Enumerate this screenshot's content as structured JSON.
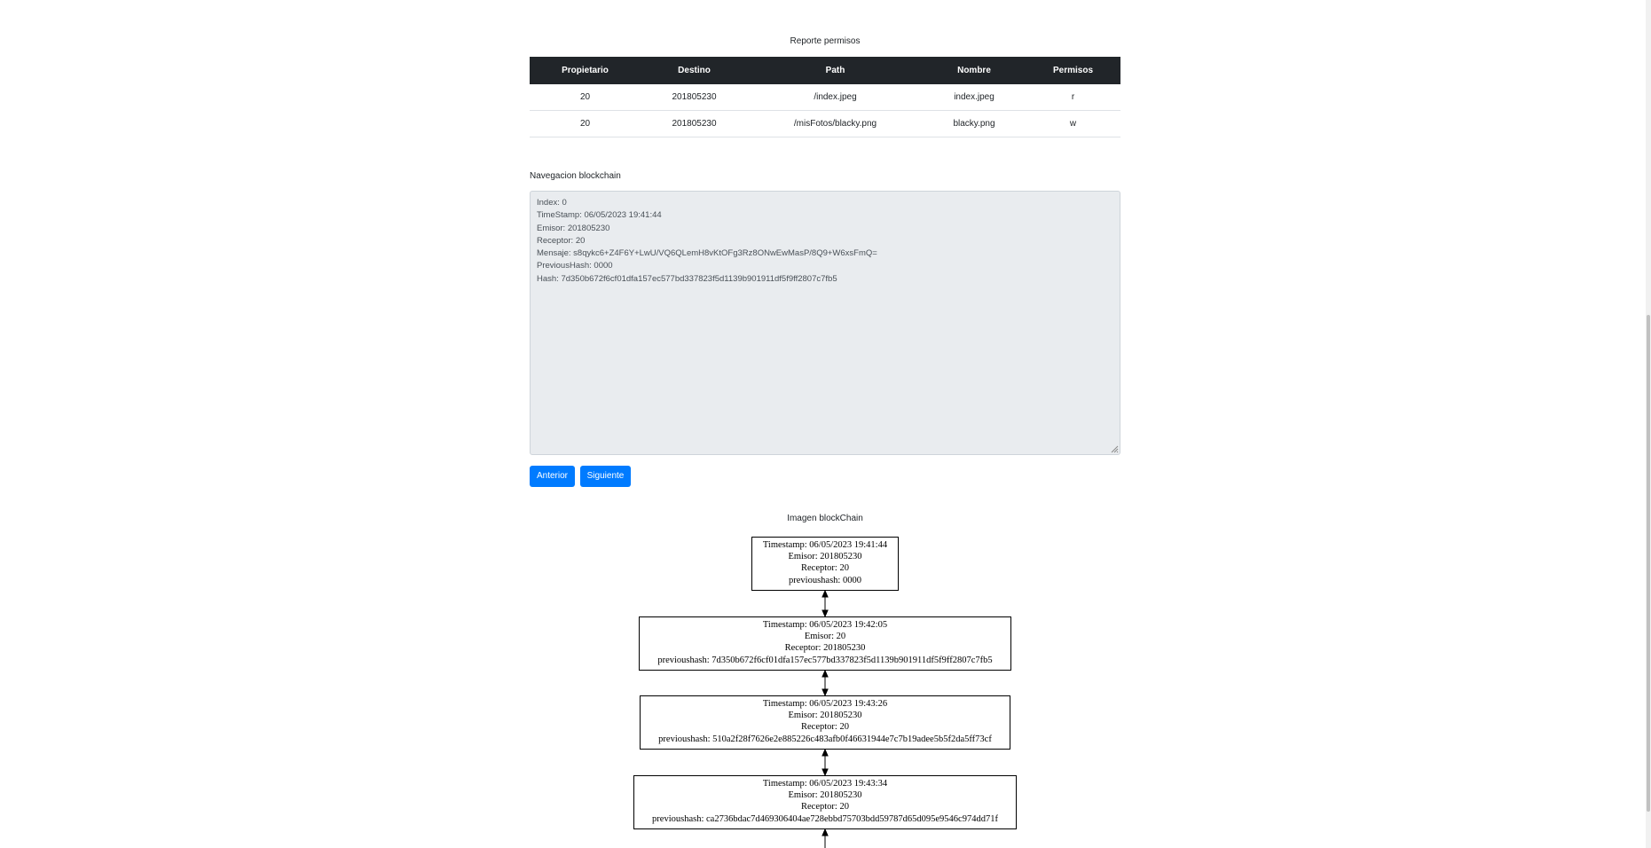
{
  "report": {
    "title": "Reporte permisos",
    "columns": [
      "Propietario",
      "Destino",
      "Path",
      "Nombre",
      "Permisos"
    ],
    "rows": [
      [
        "20",
        "201805230",
        "/index.jpeg",
        "index.jpeg",
        "r"
      ],
      [
        "20",
        "201805230",
        "/misFotos/blacky.png",
        "blacky.png",
        "w"
      ]
    ]
  },
  "navigation": {
    "title": "Navegacion blockchain",
    "lines": [
      "Index: 0",
      "TimeStamp: 06/05/2023 19:41:44",
      "Emisor: 201805230",
      "Receptor: 20",
      "Mensaje: s8qykc6+Z4F6Y+LwU/VQ6QLemH8vKtOFg3Rz8ONwEwMasP/8Q9+W6xsFmQ=",
      "PreviousHash: 0000",
      "Hash: 7d350b672f6cf01dfa157ec577bd337823f5d1139b901911df5f9ff2807c7fb5"
    ],
    "prev_label": "Anterior",
    "next_label": "Siguiente"
  },
  "image": {
    "title": "Imagen blockChain",
    "blocks": [
      [
        "Timestamp: 06/05/2023 19:41:44",
        "Emisor: 201805230",
        "Receptor: 20",
        "previoushash: 0000"
      ],
      [
        "Timestamp: 06/05/2023 19:42:05",
        "Emisor: 20",
        "Receptor: 201805230",
        "previoushash: 7d350b672f6cf01dfa157ec577bd337823f5d1139b901911df5f9ff2807c7fb5"
      ],
      [
        "Timestamp: 06/05/2023 19:43:26",
        "Emisor: 201805230",
        "Receptor: 20",
        "previoushash: 510a2f28f7626e2e885226c483afb0f46631944e7c7b19adee5b5f2da5ff73cf"
      ],
      [
        "Timestamp: 06/05/2023 19:43:34",
        "Emisor: 201805230",
        "Receptor: 20",
        "previoushash: ca2736bdac7d469306404ae728ebbd75703bdd59787d65d095e9546c974dd71f"
      ]
    ]
  },
  "colors": {
    "header_bg": "#212529",
    "button_bg": "#007bff",
    "textarea_bg": "#e9ecef"
  }
}
